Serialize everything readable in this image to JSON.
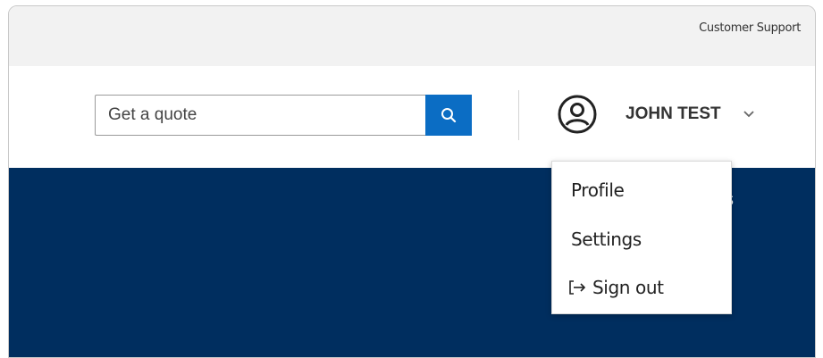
{
  "utility_bar": {
    "customer_support_label": "Customer Support"
  },
  "header": {
    "search": {
      "placeholder": "Get a quote",
      "value": "",
      "button_icon": "search-icon"
    },
    "user": {
      "avatar_icon": "user-circle-icon",
      "name": "JOHN TEST",
      "chevron_icon": "chevron-down-icon"
    }
  },
  "banner": {
    "partial_text": "s"
  },
  "user_dropdown": {
    "items": [
      {
        "label": "Profile"
      },
      {
        "label": "Settings"
      },
      {
        "label": "Sign out",
        "icon": "sign-out-icon"
      }
    ]
  },
  "colors": {
    "utility_bar_bg": "#f2f2f2",
    "search_button_bg": "#0b6dc4",
    "banner_bg": "#002e5f",
    "text": "#333333"
  }
}
